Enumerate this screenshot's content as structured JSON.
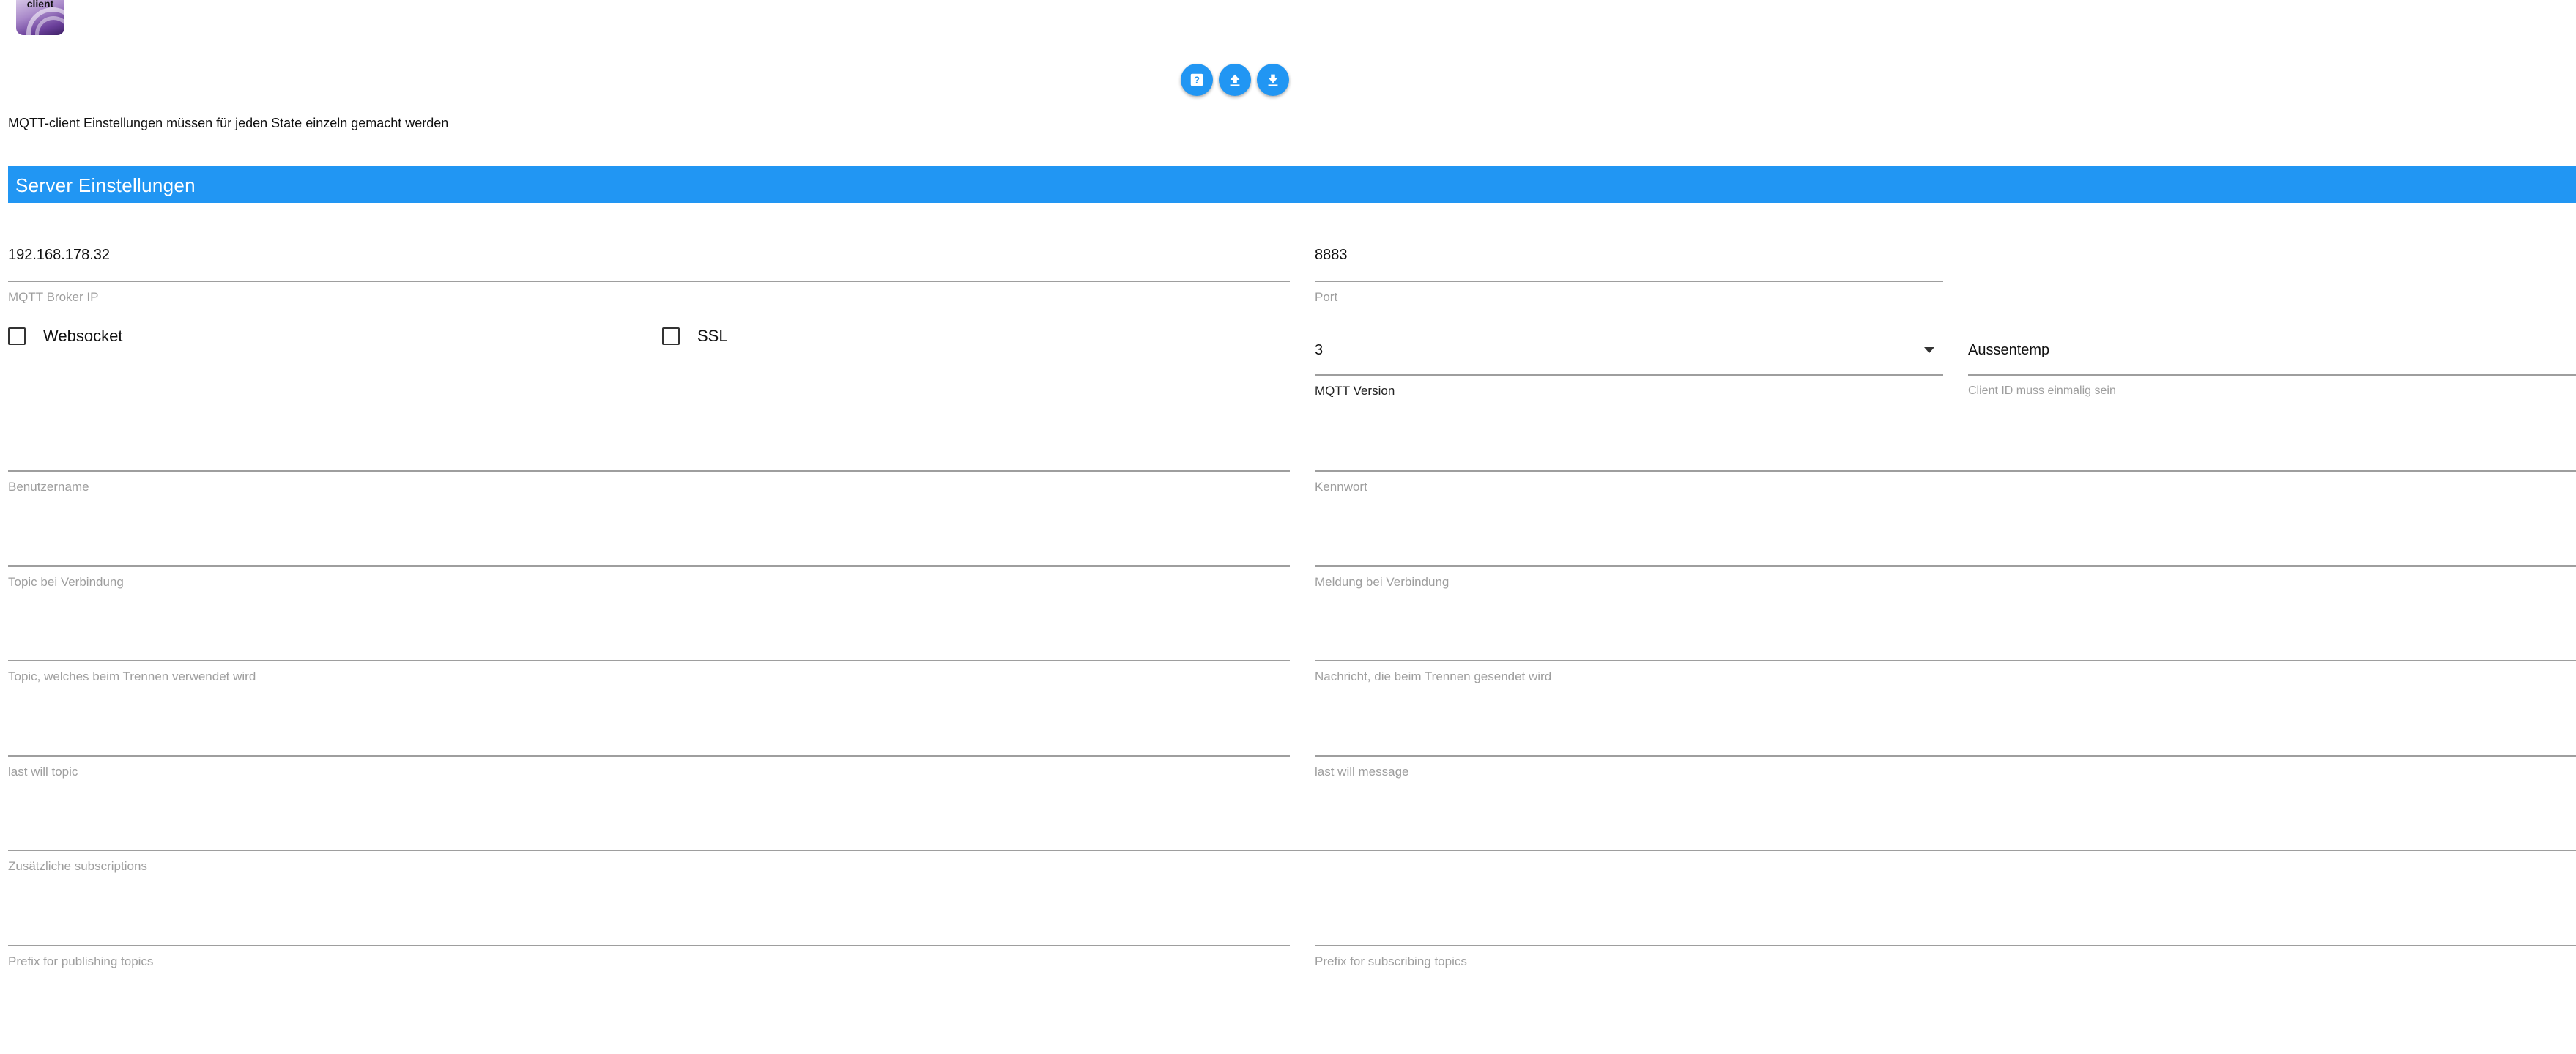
{
  "logo": {
    "text": "client"
  },
  "toolbar": {
    "buttons": [
      {
        "name": "help",
        "icon": "help-icon"
      },
      {
        "name": "upload",
        "icon": "upload-icon"
      },
      {
        "name": "download",
        "icon": "download-icon"
      }
    ]
  },
  "hint": "MQTT-client Einstellungen müssen für jeden State einzeln gemacht werden",
  "section": {
    "title": "Server Einstellungen"
  },
  "fields": {
    "broker_ip": {
      "value": "192.168.178.32",
      "label": "MQTT Broker IP"
    },
    "port": {
      "value": "8883",
      "label": "Port"
    },
    "websocket": {
      "label": "Websocket",
      "checked": false
    },
    "ssl": {
      "label": "SSL",
      "checked": false
    },
    "mqtt_version": {
      "value": "3",
      "label": "MQTT Version"
    },
    "client_id": {
      "value": "Aussentemp",
      "label": "Client ID muss einmalig sein"
    },
    "username": {
      "value": "",
      "label": "Benutzername"
    },
    "password": {
      "value": "",
      "label": "Kennwort"
    },
    "connect_topic": {
      "value": "",
      "label": "Topic bei Verbindung"
    },
    "connect_message": {
      "value": "",
      "label": "Meldung bei Verbindung"
    },
    "disconnect_topic": {
      "value": "",
      "label": "Topic, welches beim Trennen verwendet wird"
    },
    "disconnect_message": {
      "value": "",
      "label": "Nachricht, die beim Trennen gesendet wird"
    },
    "last_will_topic": {
      "value": "",
      "label": "last will topic"
    },
    "last_will_message": {
      "value": "",
      "label": "last will message"
    },
    "subscriptions": {
      "value": "",
      "label": "Zusätzliche subscriptions"
    },
    "publish_prefix": {
      "value": "",
      "label": "Prefix for publishing topics"
    },
    "subscribe_prefix": {
      "value": "",
      "label": "Prefix for subscribing topics"
    }
  },
  "colors": {
    "accent": "#2196f3",
    "line": "#9e9e9e",
    "label": "#9e9e9e"
  }
}
